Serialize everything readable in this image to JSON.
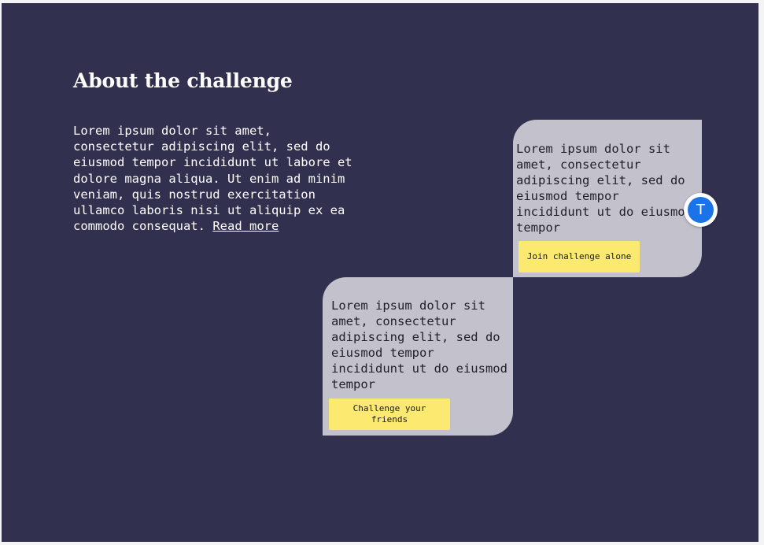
{
  "section": {
    "title": "About the challenge",
    "body": "Lorem ipsum dolor sit amet, consectetur adipiscing elit, sed do eiusmod tempor incididunt ut labore et dolore magna aliqua. Ut enim ad minim veniam, quis nostrud exercitation ullamco laboris nisi ut aliquip ex ea commodo consequat.",
    "read_more": "Read more"
  },
  "cards": {
    "solo": {
      "text": "Lorem ipsum dolor sit amet, consectetur adipiscing elit, sed do eiusmod tempor incididunt ut do eiusmod tempor",
      "button": "Join challenge alone"
    },
    "friends": {
      "text": "Lorem ipsum dolor sit amet, consectetur adipiscing elit, sed do eiusmod tempor incididunt ut do eiusmod tempor",
      "button": "Challenge your friends"
    }
  },
  "avatar": {
    "initial": "T"
  },
  "colors": {
    "background": "#32304f",
    "card": "#c3c1cb",
    "button": "#fbe970",
    "avatar": "#1a73e8"
  }
}
